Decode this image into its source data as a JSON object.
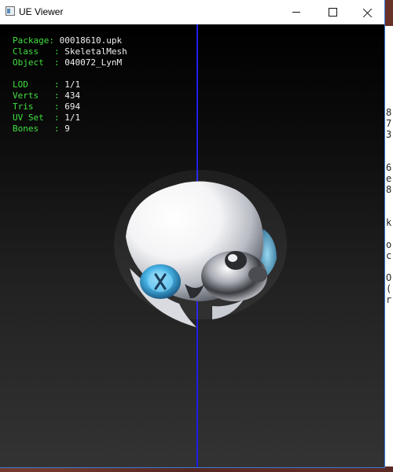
{
  "window": {
    "title": "UE Viewer"
  },
  "info": {
    "package": {
      "label": "Package",
      "value": "00018610.upk"
    },
    "class": {
      "label": "Class",
      "value": "SkeletalMesh"
    },
    "object": {
      "label": "Object",
      "value": "040072_LynM"
    },
    "lod": {
      "label": "LOD",
      "value": "1/1"
    },
    "verts": {
      "label": "Verts",
      "value": "434"
    },
    "tris": {
      "label": "Tris",
      "value": "694"
    },
    "uvset": {
      "label": "UV Set",
      "value": "1/1"
    },
    "bones": {
      "label": "Bones",
      "value": "9"
    }
  },
  "colors": {
    "label_green": "#40e040",
    "axis_blue": "#1e1ef0"
  },
  "background_text": [
    "8",
    "7",
    "3",
    "6",
    "e",
    "8",
    "k",
    "o",
    "c",
    "O",
    "(",
    "r"
  ]
}
